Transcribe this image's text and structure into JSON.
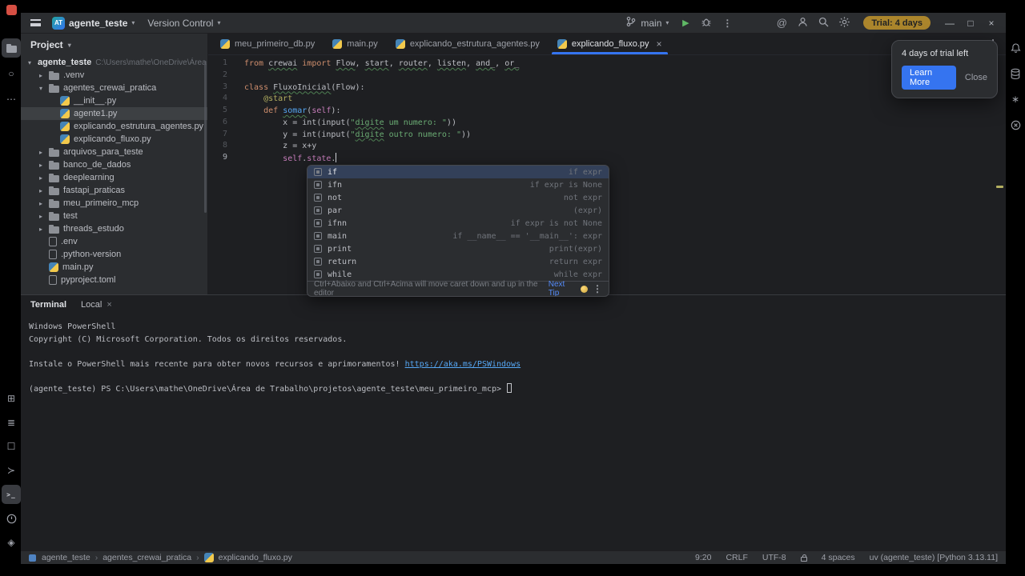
{
  "window": {
    "project_initials": "AT",
    "project": "agente_teste",
    "vcs": "Version Control",
    "branch": "main",
    "trial_badge": "Trial: 4 days"
  },
  "trial_popup": {
    "title": "4 days of trial left",
    "learn_more": "Learn More",
    "close": "Close"
  },
  "left_stripe": {
    "top": [
      {
        "name": "project-icon",
        "type": "folder",
        "active": true
      },
      {
        "name": "commit-icon",
        "glyph": "○"
      },
      {
        "name": "more-tool-windows-icon",
        "glyph": "⋯"
      }
    ],
    "bottom": [
      {
        "name": "python-packages-icon",
        "glyph": "⊞"
      },
      {
        "name": "structure-icon",
        "glyph": "≣"
      },
      {
        "name": "bookmarks-icon",
        "glyph": "☐"
      },
      {
        "name": "python-console-icon",
        "glyph": "≻"
      },
      {
        "name": "terminal-icon",
        "type": "terminal",
        "active": true
      },
      {
        "name": "problems-icon",
        "type": "problems"
      },
      {
        "name": "services-icon",
        "glyph": "◈"
      }
    ]
  },
  "right_stripe": [
    {
      "name": "notifications-icon",
      "type": "bell"
    },
    {
      "name": "database-icon",
      "type": "db"
    },
    {
      "name": "ai-assistant-icon",
      "glyph": "∗"
    },
    {
      "name": "learn-features-icon",
      "type": "circlex"
    }
  ],
  "project_panel": {
    "title": "Project",
    "items": [
      {
        "label": "agente_teste",
        "hint": "C:\\Users\\mathe\\OneDrive\\Área",
        "indent": 0,
        "icon": "none",
        "expanded": true,
        "bold": true
      },
      {
        "label": ".venv",
        "indent": 1,
        "icon": "folder",
        "expanded": false
      },
      {
        "label": "agentes_crewai_pratica",
        "indent": 1,
        "icon": "folder",
        "expanded": true
      },
      {
        "label": "__init__.py",
        "indent": 2,
        "icon": "py"
      },
      {
        "label": "agente1.py",
        "indent": 2,
        "icon": "py",
        "selected": true
      },
      {
        "label": "explicando_estrutura_agentes.py",
        "indent": 2,
        "icon": "py"
      },
      {
        "label": "explicando_fluxo.py",
        "indent": 2,
        "icon": "py"
      },
      {
        "label": "arquivos_para_teste",
        "indent": 1,
        "icon": "folder",
        "expanded": false
      },
      {
        "label": "banco_de_dados",
        "indent": 1,
        "icon": "folder",
        "expanded": false
      },
      {
        "label": "deeplearning",
        "indent": 1,
        "icon": "folder",
        "expanded": false
      },
      {
        "label": "fastapi_praticas",
        "indent": 1,
        "icon": "folder",
        "expanded": false
      },
      {
        "label": "meu_primeiro_mcp",
        "indent": 1,
        "icon": "folder",
        "expanded": false
      },
      {
        "label": "test",
        "indent": 1,
        "icon": "folder",
        "expanded": false
      },
      {
        "label": "threads_estudo",
        "indent": 1,
        "icon": "folder",
        "expanded": false
      },
      {
        "label": ".env",
        "indent": 1,
        "icon": "file"
      },
      {
        "label": ".python-version",
        "indent": 1,
        "icon": "file"
      },
      {
        "label": "main.py",
        "indent": 1,
        "icon": "py"
      },
      {
        "label": "pyproject.toml",
        "indent": 1,
        "icon": "file"
      }
    ]
  },
  "tabs": [
    {
      "label": "meu_primeiro_db.py",
      "active": false
    },
    {
      "label": "main.py",
      "active": false
    },
    {
      "label": "explicando_estrutura_agentes.py",
      "active": false
    },
    {
      "label": "explicando_fluxo.py",
      "active": true
    }
  ],
  "editor": {
    "lines": [
      {
        "n": "1",
        "t": [
          [
            "from",
            "kw"
          ],
          [
            " ",
            "pl"
          ],
          [
            "crewai",
            "pl sp"
          ],
          [
            " ",
            "pl"
          ],
          [
            "import",
            "kw"
          ],
          [
            " ",
            "pl"
          ],
          [
            "Flow",
            "pl sp"
          ],
          [
            ", ",
            "pl"
          ],
          [
            "start",
            "pl sp"
          ],
          [
            ", ",
            "pl"
          ],
          [
            "router",
            "pl sp"
          ],
          [
            ", ",
            "pl"
          ],
          [
            "listen",
            "pl sp"
          ],
          [
            ", ",
            "pl"
          ],
          [
            "and_",
            "pl sp"
          ],
          [
            ", ",
            "pl"
          ],
          [
            "or_",
            "pl sp"
          ]
        ]
      },
      {
        "n": "2",
        "t": []
      },
      {
        "n": "3",
        "t": [
          [
            "class",
            "kw"
          ],
          [
            " ",
            "pl"
          ],
          [
            "FluxoInicial",
            "pl sp"
          ],
          [
            "(Flow):",
            "pl"
          ]
        ]
      },
      {
        "n": "4",
        "t": [
          [
            "    ",
            "pl"
          ],
          [
            "@start",
            "deco"
          ]
        ]
      },
      {
        "n": "5",
        "t": [
          [
            "    ",
            "pl"
          ],
          [
            "def",
            "kw"
          ],
          [
            " ",
            "pl"
          ],
          [
            "somar",
            "fn sp"
          ],
          [
            "(",
            "pl"
          ],
          [
            "self",
            "self"
          ],
          [
            "):",
            "pl"
          ]
        ]
      },
      {
        "n": "6",
        "t": [
          [
            "        x = ",
            "pl"
          ],
          [
            "int",
            "pl"
          ],
          [
            "(",
            "pl"
          ],
          [
            "input",
            "pl"
          ],
          [
            "(",
            "pl"
          ],
          [
            "\"",
            "str"
          ],
          [
            "digite",
            "str sp"
          ],
          [
            " um numero: \"",
            "str"
          ],
          [
            "))",
            "pl"
          ]
        ]
      },
      {
        "n": "7",
        "t": [
          [
            "        y = ",
            "pl"
          ],
          [
            "int",
            "pl"
          ],
          [
            "(",
            "pl"
          ],
          [
            "input",
            "pl"
          ],
          [
            "(",
            "pl"
          ],
          [
            "\"",
            "str"
          ],
          [
            "digite",
            "str sp"
          ],
          [
            " outro numero: \"",
            "str"
          ],
          [
            "))",
            "pl"
          ]
        ]
      },
      {
        "n": "8",
        "t": [
          [
            "        z = x+y",
            "pl"
          ]
        ]
      },
      {
        "n": "9",
        "cur": true,
        "t": [
          [
            "        ",
            "pl"
          ],
          [
            "self",
            "self"
          ],
          [
            ".",
            "pl"
          ],
          [
            "state",
            "self"
          ],
          [
            ".",
            "pl"
          ]
        ]
      }
    ]
  },
  "completion": {
    "items": [
      {
        "label": "if",
        "tail": "if expr",
        "selected": true
      },
      {
        "label": "ifn",
        "tail": "if expr is None"
      },
      {
        "label": "not",
        "tail": "not expr"
      },
      {
        "label": "par",
        "tail": "(expr)"
      },
      {
        "label": "ifnn",
        "tail": "if expr is not None"
      },
      {
        "label": "main",
        "tail": "if __name__ == '__main__': expr"
      },
      {
        "label": "print",
        "tail": "print(expr)"
      },
      {
        "label": "return",
        "tail": "return expr"
      },
      {
        "label": "while",
        "tail": "while expr"
      }
    ],
    "hint": "Ctrl+Abaixo and Ctrl+Acima will move caret down and up in the editor",
    "hint_link": "Next Tip"
  },
  "terminal": {
    "title": "Terminal",
    "tab": "Local",
    "lines": [
      [
        [
          "Windows PowerShell",
          "pl"
        ]
      ],
      [
        [
          "Copyright (C) Microsoft Corporation. Todos os direitos reservados.",
          "pl"
        ]
      ],
      [],
      [
        [
          "Instale o PowerShell mais recente para obter novos recursos e aprimoramentos! ",
          "pl"
        ],
        [
          "https://aka.ms/PSWindows",
          "link"
        ]
      ],
      [],
      [
        [
          "(agente_teste) PS C:\\Users\\mathe\\OneDrive\\Área de Trabalho\\projetos\\agente_teste\\meu_primeiro_mcp> ",
          "pl"
        ]
      ]
    ]
  },
  "statusbar": {
    "breadcrumbs": [
      "agente_teste",
      "agentes_crewai_pratica",
      "explicando_fluxo.py"
    ],
    "items": [
      {
        "name": "cursor-position",
        "label": "9:20"
      },
      {
        "name": "line-separator",
        "label": "CRLF"
      },
      {
        "name": "encoding",
        "label": "UTF-8"
      },
      {
        "name": "readonly-lock",
        "label": "",
        "icon": "lock"
      },
      {
        "name": "indent",
        "label": "4 spaces"
      },
      {
        "name": "interpreter",
        "label": "uv (agente_teste) [Python 3.13.11]"
      }
    ]
  }
}
